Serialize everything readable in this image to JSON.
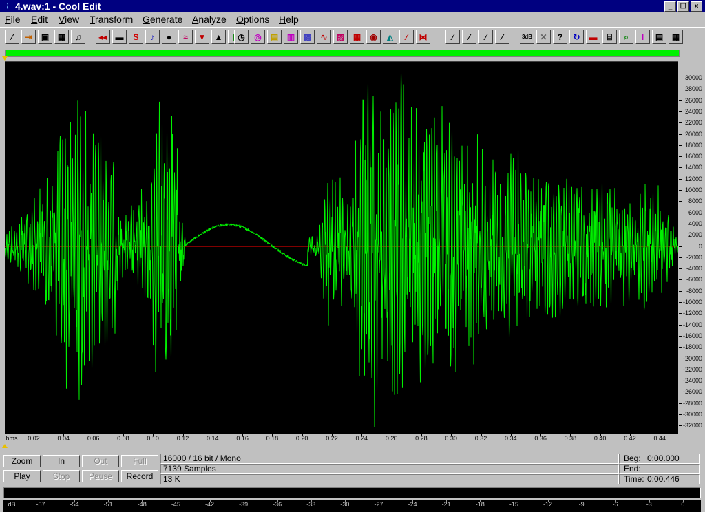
{
  "window": {
    "title": "4.wav:1 - Cool Edit",
    "controls": [
      "_",
      "❐",
      "×"
    ]
  },
  "menu": [
    "File",
    "Edit",
    "View",
    "Transform",
    "Generate",
    "Analyze",
    "Options",
    "Help"
  ],
  "toolbar": {
    "buttons": [
      {
        "name": "new-icon",
        "glyph": "⁄",
        "color": "#000000"
      },
      {
        "name": "open-icon",
        "glyph": "⇥",
        "color": "#c06000"
      },
      {
        "name": "save-icon",
        "glyph": "▣",
        "color": "#000000"
      },
      {
        "name": "save-as-icon",
        "glyph": "▦",
        "color": "#000000"
      },
      {
        "name": "headphones-icon",
        "glyph": "♫",
        "color": "#000000"
      },
      {
        "name": "rewind-icon",
        "glyph": "◂◂",
        "color": "#c00000"
      },
      {
        "name": "cut-icon",
        "glyph": "▬",
        "color": "#000000"
      },
      {
        "name": "convert-icon",
        "glyph": "S",
        "color": "#d00000"
      },
      {
        "name": "note-icon",
        "glyph": "♪",
        "color": "#0000c0"
      },
      {
        "name": "record-dot-icon",
        "glyph": "●",
        "color": "#000000"
      },
      {
        "name": "noise-icon",
        "glyph": "≈",
        "color": "#c00060"
      },
      {
        "name": "echo-icon",
        "glyph": "▼",
        "color": "#c00000"
      },
      {
        "name": "amplify-icon",
        "glyph": "▲",
        "color": "#000000"
      },
      {
        "name": "eq-icon",
        "glyph": "▮",
        "color": "#008000"
      },
      {
        "name": "clock-icon",
        "glyph": "◷",
        "color": "#000000"
      },
      {
        "name": "radiate-icon",
        "glyph": "◎",
        "color": "#c000c0"
      },
      {
        "name": "filter-icon",
        "glyph": "▤",
        "color": "#c0a000"
      },
      {
        "name": "spectrum-icon",
        "glyph": "▥",
        "color": "#c000c0"
      },
      {
        "name": "flanger-icon",
        "glyph": "▩",
        "color": "#4040c0"
      },
      {
        "name": "wave-icon",
        "glyph": "∿",
        "color": "#c00000"
      },
      {
        "name": "sweep-icon",
        "glyph": "▨",
        "color": "#c00060"
      },
      {
        "name": "grid-icon",
        "glyph": "▦",
        "color": "#c00000"
      },
      {
        "name": "stop-icon",
        "glyph": "◉",
        "color": "#a00000"
      },
      {
        "name": "dolphin-icon",
        "glyph": "◭",
        "color": "#008080"
      },
      {
        "name": "bend-icon",
        "glyph": "⁄",
        "color": "#c00000"
      },
      {
        "name": "reverse-icon",
        "glyph": "⋈",
        "color": "#c00000"
      },
      {
        "name": "meter-a-icon",
        "glyph": "⁄",
        "color": "#000000"
      },
      {
        "name": "meter-b-icon",
        "glyph": "⁄",
        "color": "#000000"
      },
      {
        "name": "meter-c-icon",
        "glyph": "⁄",
        "color": "#000000"
      },
      {
        "name": "meter-d-icon",
        "glyph": "⁄",
        "color": "#000000"
      },
      {
        "name": "db-icon",
        "glyph": "3dB",
        "color": "#000000"
      },
      {
        "name": "wrench-icon",
        "glyph": "✕",
        "color": "#606060"
      },
      {
        "name": "help-icon",
        "glyph": "?",
        "color": "#000000"
      },
      {
        "name": "loop-icon",
        "glyph": "↻",
        "color": "#0000c0"
      },
      {
        "name": "align-icon",
        "glyph": "▬",
        "color": "#c00000"
      },
      {
        "name": "cue-icon",
        "glyph": "⌸",
        "color": "#000000"
      },
      {
        "name": "zoom-icon",
        "glyph": "⌕",
        "color": "#008000"
      },
      {
        "name": "cursor-icon",
        "glyph": "I",
        "color": "#c000c0"
      },
      {
        "name": "clipboard-icon",
        "glyph": "▤",
        "color": "#000000"
      },
      {
        "name": "settings-icon",
        "glyph": "▦",
        "color": "#000000"
      }
    ]
  },
  "waveform": {
    "wave_color": "#00f000",
    "center_line_color": "#ff0000",
    "background": "#000000"
  },
  "axis": {
    "x_unit": "hms",
    "x_labels": [
      "0.02",
      "0.04",
      "0.06",
      "0.08",
      "0.10",
      "0.12",
      "0.14",
      "0.16",
      "0.18",
      "0.20",
      "0.22",
      "0.24",
      "0.26",
      "0.28",
      "0.30",
      "0.32",
      "0.34",
      "0.36",
      "0.38",
      "0.40",
      "0.42",
      "0.44"
    ],
    "y_labels": [
      "30000",
      "28000",
      "26000",
      "24000",
      "22000",
      "20000",
      "18000",
      "16000",
      "14000",
      "12000",
      "10000",
      "8000",
      "6000",
      "4000",
      "2000",
      "0",
      "-2000",
      "-4000",
      "-6000",
      "-8000",
      "-10000",
      "-12000",
      "-14000",
      "-16000",
      "-18000",
      "-20000",
      "-22000",
      "-24000",
      "-26000",
      "-28000",
      "-30000",
      "-32000"
    ]
  },
  "transport": {
    "zoom": "Zoom",
    "in": "In",
    "out": "Out",
    "full": "Full",
    "play": "Play",
    "stop": "Stop",
    "pause": "Pause",
    "record": "Record"
  },
  "info": {
    "format": "16000 / 16 bit / Mono",
    "samples": "7139 Samples",
    "size": "13 K"
  },
  "time": {
    "beg_label": "Beg:",
    "beg_value": "0:00.000",
    "end_label": "End:",
    "end_value": "",
    "time_label": "Time:",
    "time_value": "0:00.446"
  },
  "level_meter": {
    "unit": "dB",
    "labels": [
      "-57",
      "-54",
      "-51",
      "-48",
      "-45",
      "-42",
      "-39",
      "-36",
      "-33",
      "-30",
      "-27",
      "-24",
      "-21",
      "-18",
      "-15",
      "-12",
      "-9",
      "-6",
      "-3",
      "0"
    ]
  }
}
